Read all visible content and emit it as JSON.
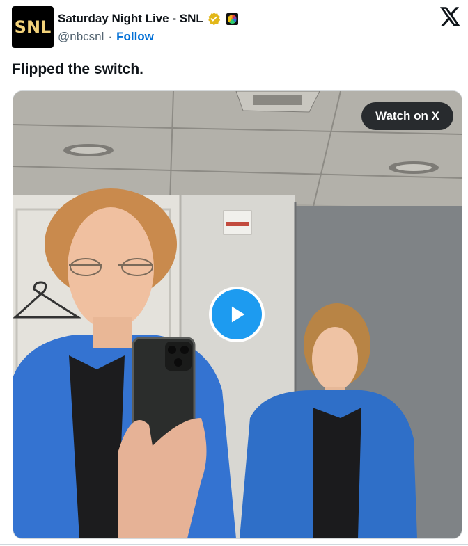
{
  "account": {
    "avatar_text": "SNL",
    "display_name": "Saturday Night Live - SNL",
    "handle": "@nbcsnl",
    "separator": "·",
    "follow_label": "Follow"
  },
  "tweet": {
    "text": "Flipped the switch."
  },
  "media": {
    "watch_label": "Watch on X",
    "play_icon": "play-icon"
  },
  "colors": {
    "follow": "#006fd6",
    "play_button": "#1d9bf0",
    "verified_badge": "#e2b719"
  }
}
